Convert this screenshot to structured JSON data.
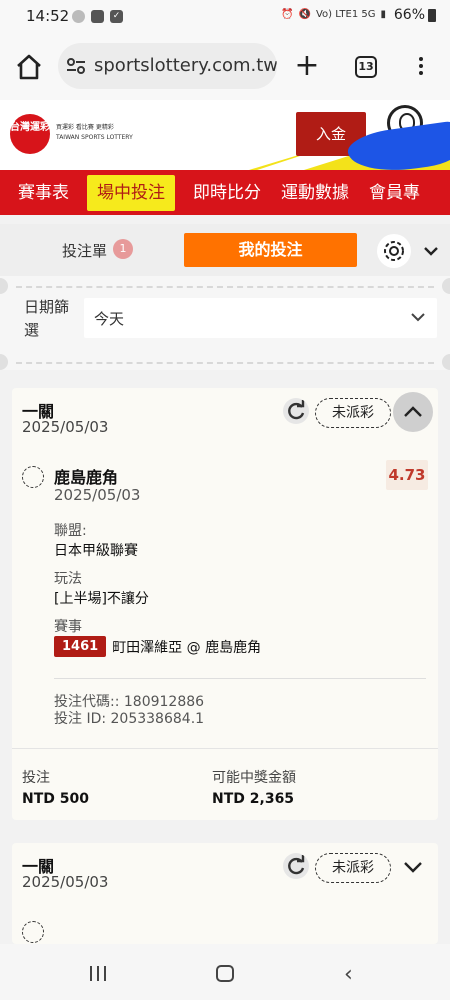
{
  "status_bar": {
    "time": "14:52",
    "signal_text": "Vo) LTE1 5G",
    "battery": "66%"
  },
  "browser": {
    "url": "sportslottery.com.tw",
    "tab_count": "13"
  },
  "site": {
    "logo_text": "台灣運彩",
    "logo_subtitle": "買運彩 看比賽 更精彩",
    "logo_english": "TAIWAN SPORTS LOTTERY",
    "deposit_label": "入金"
  },
  "nav": {
    "items": [
      "賽事表",
      "場中投注",
      "即時比分",
      "運動數據",
      "會員專"
    ],
    "active_index": 1
  },
  "slip": {
    "label": "投注單",
    "count": "1",
    "mybets_label": "我的投注"
  },
  "filter": {
    "label": "日期篩選",
    "value": "今天"
  },
  "bets": [
    {
      "title": "一關",
      "date": "2025/05/03",
      "status": "未派彩",
      "expanded": true,
      "selection": {
        "team": "鹿島鹿角",
        "date": "2025/05/03",
        "odds": "4.73",
        "league_label": "聯盟:",
        "league": "日本甲級聯賽",
        "play_label": "玩法",
        "play": "[上半場]不讓分",
        "event_label": "賽事",
        "event_id": "1461",
        "event_name": "町田澤維亞 @ 鹿島鹿角",
        "bet_code": "投注代碼:: 180912886",
        "bet_id": "投注 ID: 205338684.1"
      },
      "stake_label": "投注",
      "stake": "NTD 500",
      "payout_label": "可能中獎金額",
      "payout": "NTD 2,365"
    },
    {
      "title": "一關",
      "date": "2025/05/03",
      "status": "未派彩",
      "expanded": false
    }
  ],
  "colors": {
    "brand_red": "#d7141a",
    "active_yellow": "#f6ea1c",
    "orange": "#ff7200",
    "odds_red": "#c0392b"
  }
}
